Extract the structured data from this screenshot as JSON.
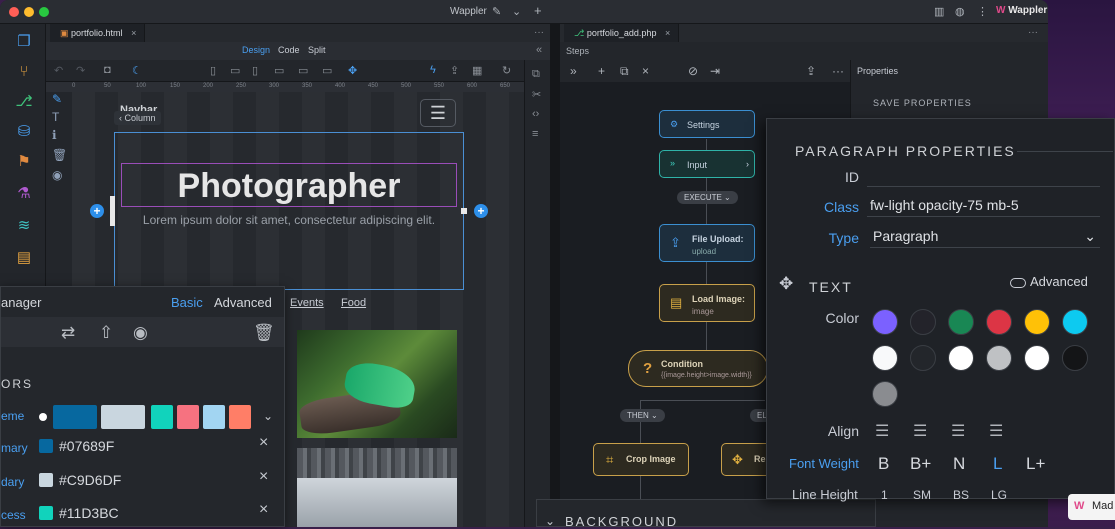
{
  "window": {
    "title": "Wappler",
    "brand": "Wappler"
  },
  "editor": {
    "tab": "portfolio.html",
    "modes": [
      "Design",
      "Code",
      "Split"
    ],
    "active_mode": "Design",
    "ruler": [
      "0",
      "50",
      "100",
      "150",
      "200",
      "250",
      "300",
      "350",
      "400",
      "450",
      "500",
      "550",
      "600",
      "650",
      "700",
      "750",
      "800",
      "850",
      "900",
      "950"
    ],
    "canvas": {
      "navbar_text": "Navbar",
      "column_button": "Column",
      "heading": "Photographer",
      "lead": "Lorem ipsum dolor sit amet, consectetur adipiscing elit.",
      "links": [
        "Events",
        "Food"
      ]
    }
  },
  "theme_manager": {
    "title": "anager",
    "tabs": [
      "Basic",
      "Advanced"
    ],
    "active_tab": "Basic",
    "section": "ORS",
    "theme_label": "eme",
    "swatches": [
      "#07689F",
      "#C9D6DF",
      "#11D3BC",
      "#F67280",
      "#A2D5F2",
      "#FF7E67"
    ],
    "rows": [
      {
        "label": "mary",
        "value": "#07689F"
      },
      {
        "label": "dary",
        "value": "#C9D6DF"
      },
      {
        "label": "cess",
        "value": "#11D3BC"
      }
    ]
  },
  "server_action": {
    "tab": "portfolio_add.php",
    "panel": "Steps",
    "nodes": {
      "settings": "Settings",
      "input": "Input",
      "execute": "EXECUTE",
      "file_upload": "File Upload:",
      "file_upload_sub": "upload",
      "load_image": "Load Image:",
      "load_image_sub": "image",
      "condition": "Condition",
      "condition_expr": "{{image.height>image.width}}",
      "then": "THEN",
      "else": "EL",
      "crop": "Crop Image",
      "resize": "Re"
    }
  },
  "properties": {
    "title": "Properties",
    "save": "SAVE PROPERTIES"
  },
  "paragraph_props": {
    "heading": "PARAGRAPH PROPERTIES",
    "id_label": "ID",
    "id_value": "",
    "class_label": "Class",
    "class_value": "fw-light opacity-75 mb-5",
    "type_label": "Type",
    "type_value": "Paragraph",
    "text_heading": "TEXT",
    "advanced": "Advanced",
    "color_label": "Color",
    "colors": [
      "#7b61ff",
      "#23232a",
      "#198754",
      "#dc3545",
      "#ffc107",
      "#0dcaf0",
      "#f8f9fa",
      "#23262b",
      "#ffffff",
      "#bfc1c4",
      "#ffffff",
      "#141517",
      "#8a8c90"
    ],
    "align_label": "Align",
    "font_weight_label": "Font Weight",
    "weights": [
      "B",
      "B+",
      "N",
      "L",
      "L+"
    ],
    "active_weight": "L",
    "line_height_label": "Line Height",
    "line_heights": [
      "1",
      "SM",
      "BS",
      "LG"
    ]
  },
  "background_panel": "BACKGROUND",
  "made_badge": "Mad"
}
